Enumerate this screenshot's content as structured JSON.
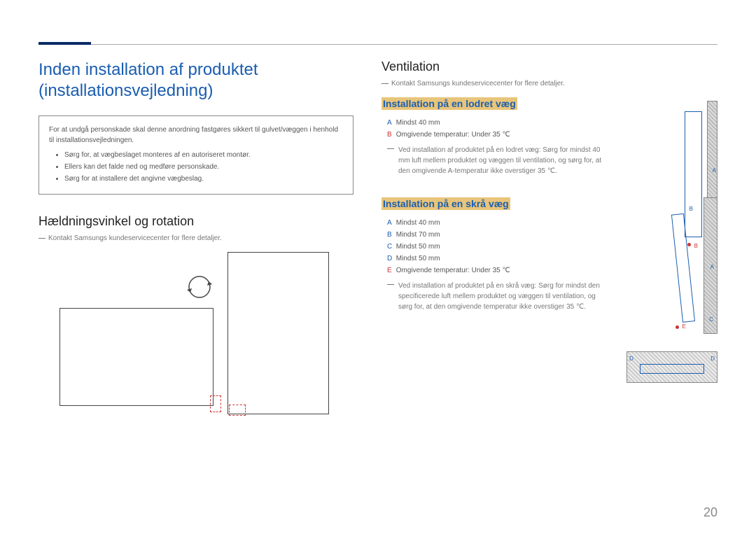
{
  "page_number": "20",
  "main_heading_line1": "Inden installation af produktet",
  "main_heading_line2": "(installationsvejledning)",
  "warning": {
    "intro": "For at undgå personskade skal denne anordning fastgøres sikkert til gulvet/væggen i henhold til installationsvejledningen.",
    "bullets": [
      "Sørg for, at vægbeslaget monteres af en autoriseret montør.",
      "Ellers kan det falde ned og medføre personskade.",
      "Sørg for at installere det angivne vægbeslag."
    ]
  },
  "tilt": {
    "heading": "Hældningsvinkel og rotation",
    "note": "Kontakt Samsungs kundeservicecenter for flere detaljer."
  },
  "ventilation": {
    "heading": "Ventilation",
    "note": "Kontakt Samsungs kundeservicecenter for flere detaljer.",
    "vertical": {
      "heading": "Installation på en lodret væg",
      "specs": {
        "A": "Mindst 40 mm",
        "B": "Omgivende temperatur: Under 35 ℃"
      },
      "note": "Ved installation af produktet på en lodret væg: Sørg for mindst 40 mm luft mellem produktet og væggen til ventilation, og sørg for, at den omgivende A-temperatur ikke overstiger 35 ℃."
    },
    "slanted": {
      "heading": "Installation på en skrå væg",
      "specs": {
        "A": "Mindst 40 mm",
        "B": "Mindst 70 mm",
        "C": "Mindst 50 mm",
        "D": "Mindst 50 mm",
        "E": "Omgivende temperatur: Under 35 ℃"
      },
      "note": "Ved installation af produktet på en skrå væg: Sørg for mindst den specificerede luft mellem produktet og væggen til ventilation, og sørg for, at den omgivende temperatur ikke overstiger 35 ℃."
    }
  },
  "labels": {
    "A": "A",
    "B": "B",
    "C": "C",
    "D": "D",
    "E": "E"
  }
}
